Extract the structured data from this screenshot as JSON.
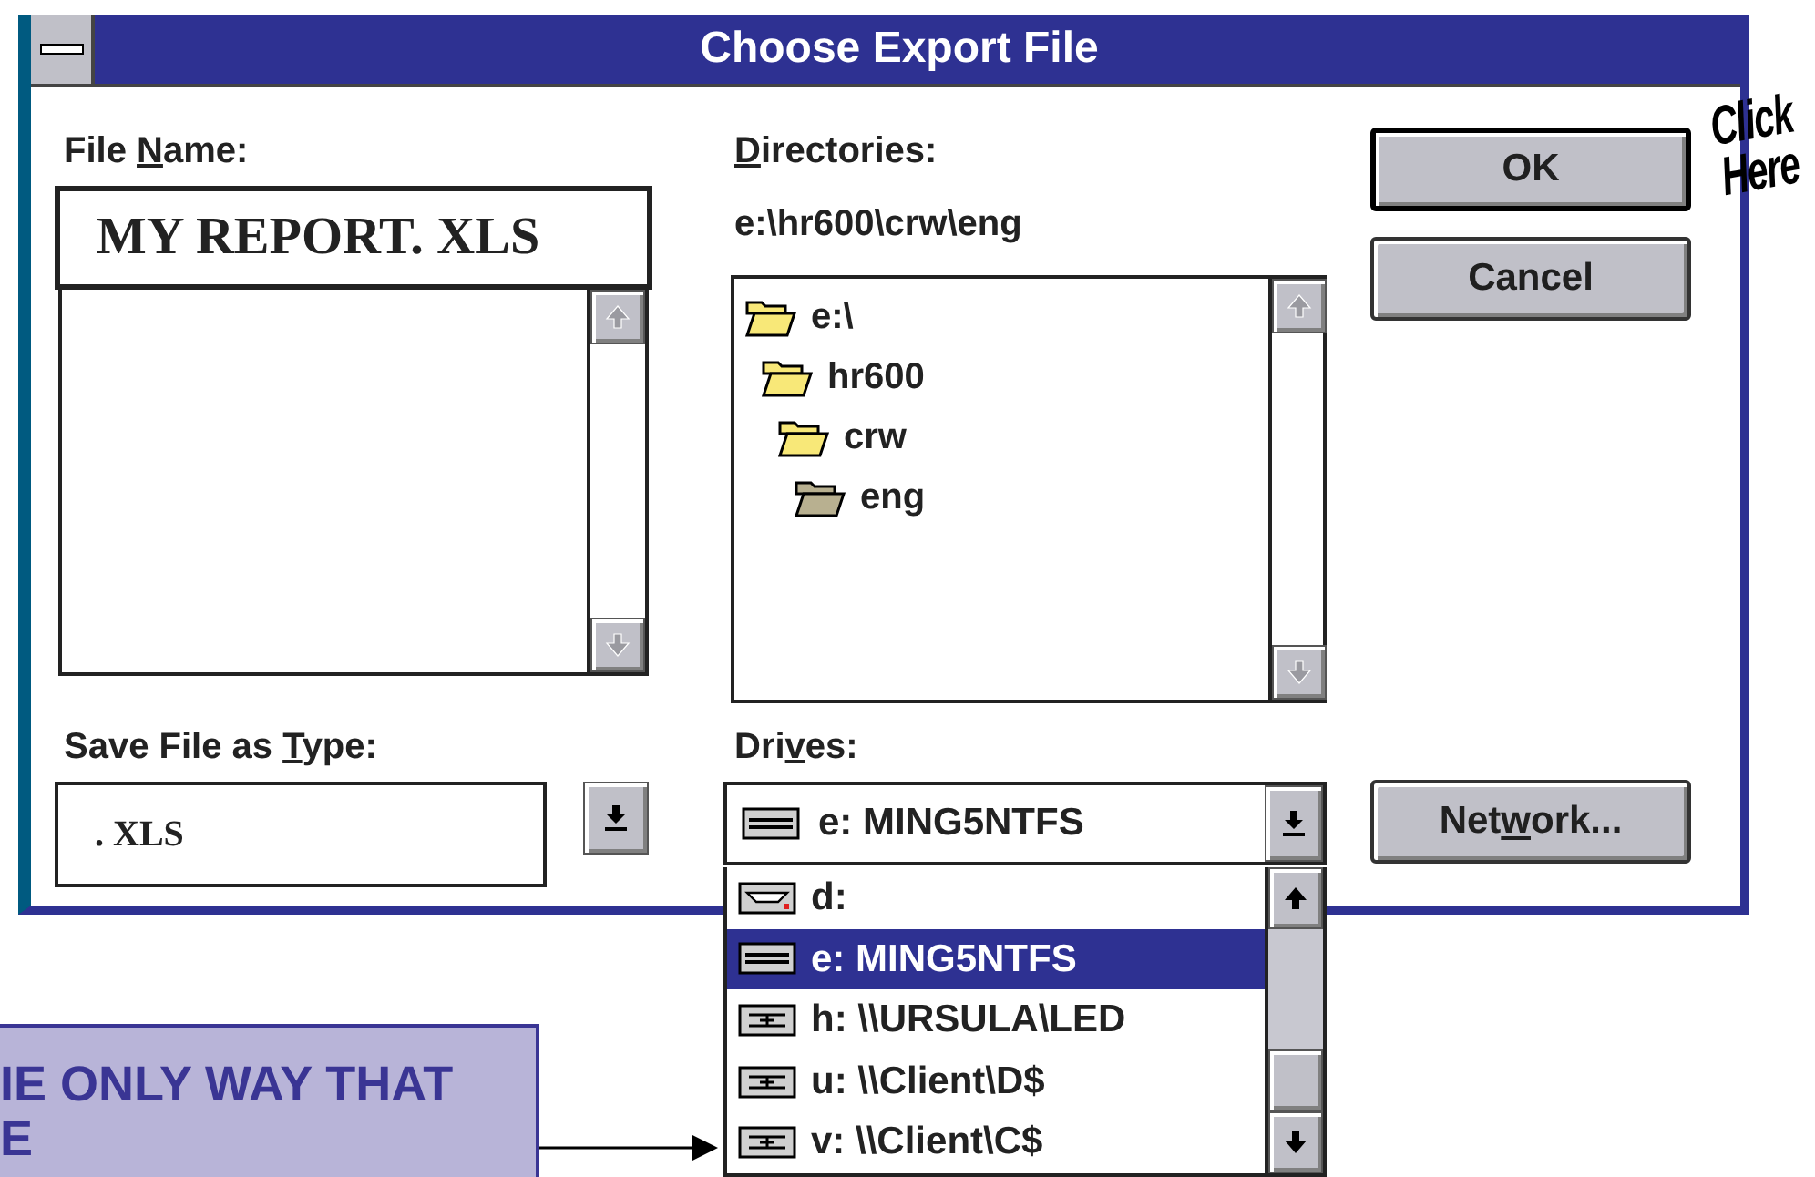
{
  "window": {
    "title": "Choose Export File"
  },
  "file_name": {
    "label": {
      "before": "File ",
      "mnemonic": "N",
      "after": "ame:"
    },
    "value": "MY REPORT. XLS"
  },
  "save_type": {
    "label": {
      "before": "Save File as ",
      "mnemonic": "T",
      "after": "ype:"
    },
    "value": ". XLS"
  },
  "directories": {
    "label": {
      "mnemonic": "D",
      "after": "irectories:"
    },
    "path": "e:\\hr600\\crw\\eng",
    "tree": [
      {
        "name": "e:\\",
        "current": false,
        "children": [
          {
            "name": "hr600",
            "current": false,
            "children": [
              {
                "name": "crw",
                "current": false,
                "children": [
                  {
                    "name": "eng",
                    "current": true
                  }
                ]
              }
            ]
          }
        ]
      }
    ]
  },
  "drives": {
    "label": {
      "before": "Dri",
      "mnemonic": "v",
      "after": "es:"
    },
    "value": {
      "kind": "hard_disk",
      "text": "e: MING5NTFS"
    },
    "options": [
      {
        "kind": "cdrom",
        "text": "d:",
        "selected": false
      },
      {
        "kind": "hard_disk",
        "text": "e: MING5NTFS",
        "selected": true
      },
      {
        "kind": "network",
        "text": "h: \\\\URSULA\\LED",
        "selected": false
      },
      {
        "kind": "network",
        "text": "u: \\\\Client\\D$",
        "selected": false
      },
      {
        "kind": "network",
        "text": "v: \\\\Client\\C$",
        "selected": false
      }
    ]
  },
  "buttons": [
    {
      "label": {
        "before": "OK"
      },
      "default": true
    },
    {
      "label": {
        "before": "Cancel"
      },
      "default": false
    }
  ],
  "network_button": {
    "label": {
      "before": "Net",
      "mnemonic": "w",
      "after": "ork..."
    },
    "default": false
  },
  "annotations": {
    "click_label": "Click Here",
    "callout_lines": [
      "IE ONLY WAY THAT",
      "E"
    ]
  }
}
